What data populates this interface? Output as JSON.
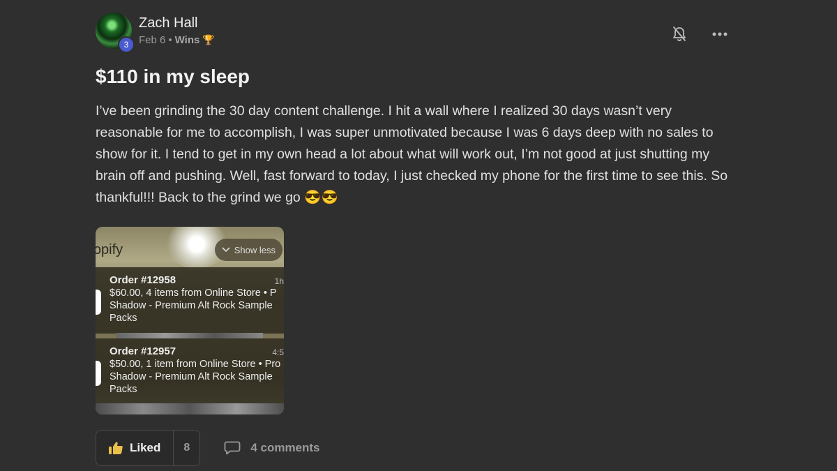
{
  "post": {
    "author": "Zach Hall",
    "level": "3",
    "date": "Feb 6",
    "separator": "•",
    "category": "Wins",
    "category_emoji": "🏆",
    "title": "$110 in my sleep",
    "body": "I’ve been grinding the 30 day content challenge. I hit a wall where I realized 30 days wasn’t very reasonable for me to accomplish, I was super unmotivated because I was 6 days deep with no sales to show for it. I tend to get in my own head a lot about what will work out, I’m not good at just shutting my brain off and pushing. Well, fast forward to today, I just checked my phone for the first time to see this. So thankful!!! Back to the grind we go 😎😎"
  },
  "attachment": {
    "app_text": "ɔpify",
    "show_less_label": "Show less",
    "notifications": [
      {
        "order": "Order #12958",
        "time": "1h",
        "line1": "$60.00, 4 items from Online Store • P",
        "line2": "Shadow - Premium Alt Rock Sample",
        "line3": "Packs"
      },
      {
        "order": "Order #12957",
        "time": "4:5",
        "line1": "$50.00, 1 item from Online Store • Pro",
        "line2": "Shadow - Premium Alt Rock Sample",
        "line3": "Packs"
      }
    ]
  },
  "footer": {
    "like_label": "Liked",
    "like_count": "8",
    "comments_label": "4 comments"
  },
  "icons": {
    "bell": "bell-off-icon",
    "more": "more-horizontal-icon",
    "like": "thumbs-up-icon",
    "comment": "comment-icon"
  },
  "colors": {
    "background": "#2f2f2f",
    "level_badge": "#4a5bd0",
    "like_icon": "#e8c04a"
  }
}
